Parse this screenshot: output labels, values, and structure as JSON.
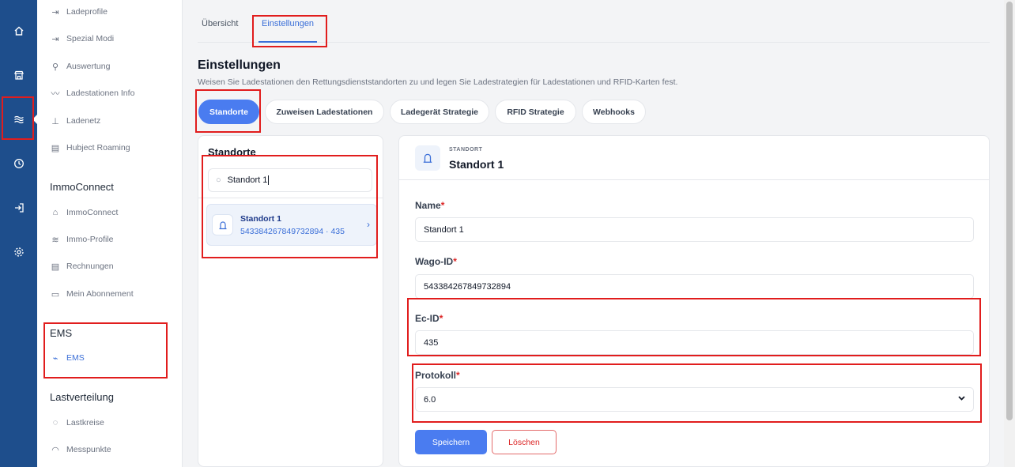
{
  "rail": {
    "icons": [
      "home-icon",
      "store-icon",
      "waves-icon",
      "clock-icon",
      "login-icon",
      "gear-icon"
    ]
  },
  "sidebar": {
    "items_top": [
      {
        "label": "Ladeprofile",
        "icon": "login-icon"
      },
      {
        "label": "Spezial Modi",
        "icon": "login-icon"
      },
      {
        "label": "Auswertung",
        "icon": "search-icon"
      },
      {
        "label": "Ladestationen Info",
        "icon": "trend-icon"
      },
      {
        "label": "Ladenetz",
        "icon": "network-icon"
      },
      {
        "label": "Hubject Roaming",
        "icon": "document-icon"
      }
    ],
    "immoconnect": {
      "title": "ImmoConnect",
      "items": [
        {
          "label": "ImmoConnect",
          "icon": "home-icon"
        },
        {
          "label": "Immo-Profile",
          "icon": "waves-icon"
        },
        {
          "label": "Rechnungen",
          "icon": "document-icon"
        },
        {
          "label": "Mein Abonnement",
          "icon": "credit-card-icon"
        }
      ]
    },
    "ems": {
      "title": "EMS",
      "items": [
        {
          "label": "EMS",
          "icon": "pulse-icon"
        }
      ]
    },
    "lastverteilung": {
      "title": "Lastverteilung",
      "items": [
        {
          "label": "Lastkreise",
          "icon": "circle-icon"
        },
        {
          "label": "Messpunkte",
          "icon": "gauge-icon"
        }
      ]
    }
  },
  "main": {
    "tabs": [
      {
        "label": "Übersicht"
      },
      {
        "label": "Einstellungen"
      }
    ],
    "title": "Einstellungen",
    "subtitle": "Weisen Sie Ladestationen den Rettungsdienststandorten zu und legen Sie Ladestrategien für Ladestationen und RFID-Karten fest.",
    "pills": [
      {
        "label": "Standorte"
      },
      {
        "label": "Zuweisen Ladestationen"
      },
      {
        "label": "Ladegerät Strategie"
      },
      {
        "label": "RFID Strategie"
      },
      {
        "label": "Webhooks"
      }
    ],
    "list": {
      "title": "Standorte",
      "search_value": "Standort 1",
      "items": [
        {
          "name": "Standort 1",
          "sub": "543384267849732894 · 435"
        }
      ]
    },
    "detail": {
      "kicker": "STANDORT",
      "title": "Standort 1",
      "required_mark": "*",
      "fields": {
        "name": {
          "label": "Name",
          "value": "Standort 1"
        },
        "wago": {
          "label": "Wago-ID",
          "value": "543384267849732894"
        },
        "ec": {
          "label": "Ec-ID",
          "value": "435"
        },
        "protokoll": {
          "label": "Protokoll",
          "value": "6.0"
        }
      },
      "save_label": "Speichern",
      "delete_label": "Löschen"
    }
  },
  "colors": {
    "rail": "#1e4e8c",
    "accent": "#4a7cf0",
    "danger": "#dc2626",
    "annotation": "#e11d1d"
  }
}
